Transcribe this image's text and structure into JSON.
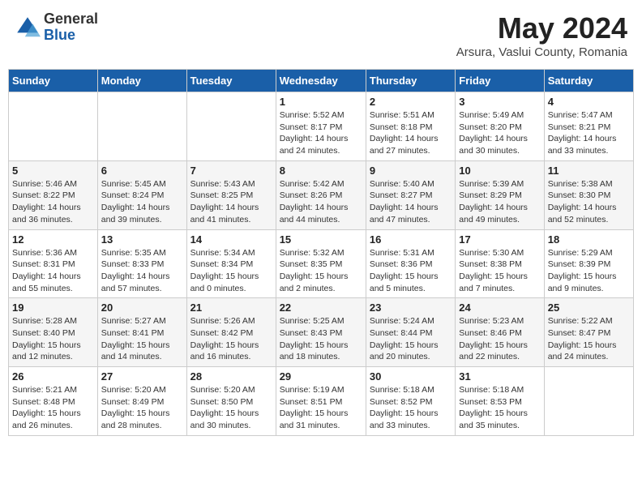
{
  "header": {
    "logo_general": "General",
    "logo_blue": "Blue",
    "month_title": "May 2024",
    "subtitle": "Arsura, Vaslui County, Romania"
  },
  "weekdays": [
    "Sunday",
    "Monday",
    "Tuesday",
    "Wednesday",
    "Thursday",
    "Friday",
    "Saturday"
  ],
  "weeks": [
    [
      {
        "day": "",
        "info": ""
      },
      {
        "day": "",
        "info": ""
      },
      {
        "day": "",
        "info": ""
      },
      {
        "day": "1",
        "info": "Sunrise: 5:52 AM\nSunset: 8:17 PM\nDaylight: 14 hours and 24 minutes."
      },
      {
        "day": "2",
        "info": "Sunrise: 5:51 AM\nSunset: 8:18 PM\nDaylight: 14 hours and 27 minutes."
      },
      {
        "day": "3",
        "info": "Sunrise: 5:49 AM\nSunset: 8:20 PM\nDaylight: 14 hours and 30 minutes."
      },
      {
        "day": "4",
        "info": "Sunrise: 5:47 AM\nSunset: 8:21 PM\nDaylight: 14 hours and 33 minutes."
      }
    ],
    [
      {
        "day": "5",
        "info": "Sunrise: 5:46 AM\nSunset: 8:22 PM\nDaylight: 14 hours and 36 minutes."
      },
      {
        "day": "6",
        "info": "Sunrise: 5:45 AM\nSunset: 8:24 PM\nDaylight: 14 hours and 39 minutes."
      },
      {
        "day": "7",
        "info": "Sunrise: 5:43 AM\nSunset: 8:25 PM\nDaylight: 14 hours and 41 minutes."
      },
      {
        "day": "8",
        "info": "Sunrise: 5:42 AM\nSunset: 8:26 PM\nDaylight: 14 hours and 44 minutes."
      },
      {
        "day": "9",
        "info": "Sunrise: 5:40 AM\nSunset: 8:27 PM\nDaylight: 14 hours and 47 minutes."
      },
      {
        "day": "10",
        "info": "Sunrise: 5:39 AM\nSunset: 8:29 PM\nDaylight: 14 hours and 49 minutes."
      },
      {
        "day": "11",
        "info": "Sunrise: 5:38 AM\nSunset: 8:30 PM\nDaylight: 14 hours and 52 minutes."
      }
    ],
    [
      {
        "day": "12",
        "info": "Sunrise: 5:36 AM\nSunset: 8:31 PM\nDaylight: 14 hours and 55 minutes."
      },
      {
        "day": "13",
        "info": "Sunrise: 5:35 AM\nSunset: 8:33 PM\nDaylight: 14 hours and 57 minutes."
      },
      {
        "day": "14",
        "info": "Sunrise: 5:34 AM\nSunset: 8:34 PM\nDaylight: 15 hours and 0 minutes."
      },
      {
        "day": "15",
        "info": "Sunrise: 5:32 AM\nSunset: 8:35 PM\nDaylight: 15 hours and 2 minutes."
      },
      {
        "day": "16",
        "info": "Sunrise: 5:31 AM\nSunset: 8:36 PM\nDaylight: 15 hours and 5 minutes."
      },
      {
        "day": "17",
        "info": "Sunrise: 5:30 AM\nSunset: 8:38 PM\nDaylight: 15 hours and 7 minutes."
      },
      {
        "day": "18",
        "info": "Sunrise: 5:29 AM\nSunset: 8:39 PM\nDaylight: 15 hours and 9 minutes."
      }
    ],
    [
      {
        "day": "19",
        "info": "Sunrise: 5:28 AM\nSunset: 8:40 PM\nDaylight: 15 hours and 12 minutes."
      },
      {
        "day": "20",
        "info": "Sunrise: 5:27 AM\nSunset: 8:41 PM\nDaylight: 15 hours and 14 minutes."
      },
      {
        "day": "21",
        "info": "Sunrise: 5:26 AM\nSunset: 8:42 PM\nDaylight: 15 hours and 16 minutes."
      },
      {
        "day": "22",
        "info": "Sunrise: 5:25 AM\nSunset: 8:43 PM\nDaylight: 15 hours and 18 minutes."
      },
      {
        "day": "23",
        "info": "Sunrise: 5:24 AM\nSunset: 8:44 PM\nDaylight: 15 hours and 20 minutes."
      },
      {
        "day": "24",
        "info": "Sunrise: 5:23 AM\nSunset: 8:46 PM\nDaylight: 15 hours and 22 minutes."
      },
      {
        "day": "25",
        "info": "Sunrise: 5:22 AM\nSunset: 8:47 PM\nDaylight: 15 hours and 24 minutes."
      }
    ],
    [
      {
        "day": "26",
        "info": "Sunrise: 5:21 AM\nSunset: 8:48 PM\nDaylight: 15 hours and 26 minutes."
      },
      {
        "day": "27",
        "info": "Sunrise: 5:20 AM\nSunset: 8:49 PM\nDaylight: 15 hours and 28 minutes."
      },
      {
        "day": "28",
        "info": "Sunrise: 5:20 AM\nSunset: 8:50 PM\nDaylight: 15 hours and 30 minutes."
      },
      {
        "day": "29",
        "info": "Sunrise: 5:19 AM\nSunset: 8:51 PM\nDaylight: 15 hours and 31 minutes."
      },
      {
        "day": "30",
        "info": "Sunrise: 5:18 AM\nSunset: 8:52 PM\nDaylight: 15 hours and 33 minutes."
      },
      {
        "day": "31",
        "info": "Sunrise: 5:18 AM\nSunset: 8:53 PM\nDaylight: 15 hours and 35 minutes."
      },
      {
        "day": "",
        "info": ""
      }
    ]
  ]
}
